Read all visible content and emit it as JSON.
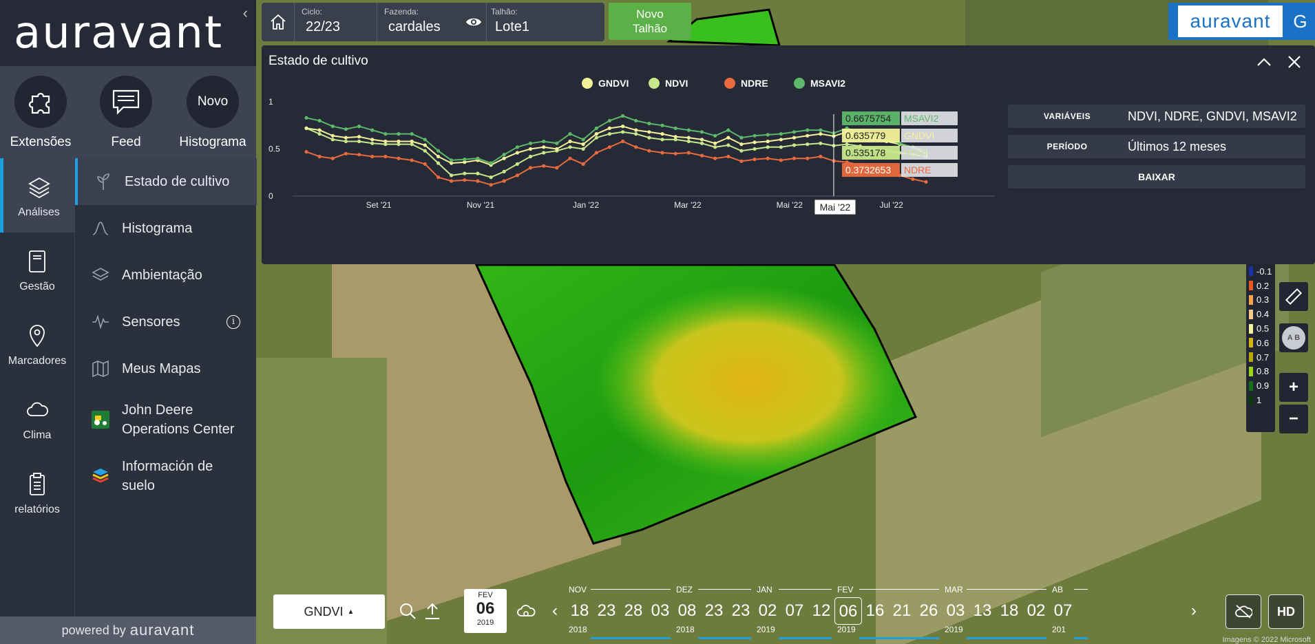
{
  "brand": {
    "logo": "auravant",
    "powered_prefix": "powered by",
    "powered_brand": "auravant",
    "right_logo": "auravant",
    "right_letter": "G"
  },
  "quick_actions": [
    {
      "label": "Extensões",
      "icon": "puzzle-icon"
    },
    {
      "label": "Feed",
      "icon": "chat-icon"
    },
    {
      "label": "Histograma",
      "icon_text": "Novo"
    }
  ],
  "nav": [
    {
      "label": "Análises",
      "icon": "layers-icon",
      "active": true
    },
    {
      "label": "Gestão",
      "icon": "notebook-icon"
    },
    {
      "label": "Marcadores",
      "icon": "pin-icon"
    },
    {
      "label": "Clima",
      "icon": "cloud-icon"
    },
    {
      "label": "relatórios",
      "icon": "report-icon"
    }
  ],
  "sub_nav": [
    {
      "label": "Estado de cultivo",
      "icon": "plant-icon",
      "active": true
    },
    {
      "label": "Histograma",
      "icon": "curve-icon"
    },
    {
      "label": "Ambientação",
      "icon": "stack-icon"
    },
    {
      "label": "Sensores",
      "icon": "signal-icon",
      "info_icon": "info-icon"
    },
    {
      "label": "Meus Mapas",
      "icon": "map-icon"
    },
    {
      "label": "John Deere Operations Center",
      "icon": "tractor-icon"
    },
    {
      "label": "Información de suelo",
      "icon": "soil-layers-icon"
    }
  ],
  "topbar": {
    "ciclo_label": "Ciclo:",
    "ciclo_value": "22/23",
    "fazenda_label": "Fazenda:",
    "fazenda_value": "cardales",
    "talhao_label": "Talhão:",
    "talhao_value": "Lote1",
    "novo_talhao_line1": "Novo",
    "novo_talhao_line2": "Talhão"
  },
  "panel": {
    "title": "Estado de cultivo",
    "info": [
      {
        "key": "VARIÁVEIS",
        "value": "NDVI, NDRE, GNDVI, MSAVI2"
      },
      {
        "key": "PERÍODO",
        "value": "Últimos 12 meses"
      }
    ],
    "download_label": "BAIXAR"
  },
  "chart_data": {
    "type": "line",
    "legend_position": "top",
    "yticks": [
      "1",
      "0.5",
      "0"
    ],
    "ylim": [
      0,
      1
    ],
    "xticks": [
      "Set '21",
      "Nov '21",
      "Jan '22",
      "Mar '22",
      "Mai '22",
      "Jul '22"
    ],
    "hover_label": "Mai '22",
    "series": [
      {
        "name": "GNDVI",
        "color": "#f3f29a",
        "hover_value": "0.635779",
        "values": [
          0.72,
          0.7,
          0.64,
          0.62,
          0.63,
          0.6,
          0.58,
          0.58,
          0.58,
          0.54,
          0.42,
          0.35,
          0.36,
          0.38,
          0.33,
          0.4,
          0.46,
          0.5,
          0.52,
          0.5,
          0.58,
          0.55,
          0.66,
          0.72,
          0.74,
          0.7,
          0.68,
          0.66,
          0.63,
          0.62,
          0.6,
          0.56,
          0.62,
          0.55,
          0.57,
          0.58,
          0.6,
          0.62,
          0.64,
          0.66,
          0.636,
          0.68,
          0.63,
          0.6,
          0.58,
          0.55,
          0.52,
          0.45
        ]
      },
      {
        "name": "NDVI",
        "color": "#c7e88a",
        "hover_value": "0.535178",
        "values": [
          0.72,
          0.66,
          0.6,
          0.58,
          0.58,
          0.56,
          0.55,
          0.55,
          0.55,
          0.48,
          0.35,
          0.22,
          0.24,
          0.24,
          0.2,
          0.26,
          0.34,
          0.42,
          0.46,
          0.48,
          0.52,
          0.5,
          0.62,
          0.66,
          0.68,
          0.66,
          0.62,
          0.6,
          0.6,
          0.58,
          0.56,
          0.52,
          0.54,
          0.48,
          0.5,
          0.52,
          0.52,
          0.54,
          0.55,
          0.56,
          0.535,
          0.55,
          0.53,
          0.5,
          0.48,
          0.46,
          0.44,
          0.42
        ]
      },
      {
        "name": "NDRE",
        "color": "#e86a3d",
        "hover_value": "0.3732653",
        "values": [
          0.47,
          0.42,
          0.4,
          0.45,
          0.44,
          0.42,
          0.42,
          0.4,
          0.38,
          0.34,
          0.2,
          0.16,
          0.17,
          0.16,
          0.12,
          0.16,
          0.22,
          0.3,
          0.32,
          0.3,
          0.4,
          0.34,
          0.46,
          0.52,
          0.58,
          0.52,
          0.48,
          0.46,
          0.45,
          0.46,
          0.43,
          0.4,
          0.42,
          0.37,
          0.39,
          0.4,
          0.38,
          0.4,
          0.4,
          0.42,
          0.373,
          0.36,
          0.33,
          0.3,
          0.26,
          0.22,
          0.18,
          0.15
        ]
      },
      {
        "name": "MSAVI2",
        "color": "#5db86a",
        "hover_value": "0.6675754",
        "values": [
          0.83,
          0.8,
          0.74,
          0.71,
          0.74,
          0.7,
          0.66,
          0.66,
          0.66,
          0.6,
          0.48,
          0.38,
          0.39,
          0.4,
          0.35,
          0.44,
          0.52,
          0.56,
          0.58,
          0.56,
          0.66,
          0.6,
          0.72,
          0.8,
          0.85,
          0.8,
          0.77,
          0.75,
          0.72,
          0.7,
          0.68,
          0.64,
          0.7,
          0.62,
          0.64,
          0.65,
          0.66,
          0.68,
          0.7,
          0.7,
          0.668,
          0.72,
          0.68,
          0.64,
          0.6,
          0.56,
          0.52,
          0.48
        ]
      }
    ]
  },
  "legend_values": [
    "-0.1",
    "0.2",
    "0.3",
    "0.4",
    "0.5",
    "0.6",
    "0.7",
    "0.8",
    "0.9",
    "1"
  ],
  "legend_colors": [
    "#1830a8",
    "#e6581f",
    "#f6a44c",
    "#f9c98a",
    "#f7f09a",
    "#d6b410",
    "#b9a706",
    "#9bd418",
    "#166e16",
    "#0b3b0b"
  ],
  "timeline": {
    "index": "GNDVI",
    "date_month": "FEV",
    "date_day": "06",
    "date_year": "2019",
    "days": [
      "18",
      "23",
      "28",
      "03",
      "08",
      "23",
      "23",
      "02",
      "07",
      "12",
      "06",
      "16",
      "21",
      "26",
      "03",
      "13",
      "18",
      "02",
      "07"
    ],
    "selected_index": 10,
    "months": [
      "NOV",
      "DEZ",
      "JAN",
      "FEV",
      "MAR",
      "AB"
    ],
    "years": [
      "2018",
      "2018",
      "2019",
      "2019",
      "2019",
      "201"
    ],
    "hd_label": "HD",
    "attribution": "Imagens © 2022 Microsoft"
  }
}
